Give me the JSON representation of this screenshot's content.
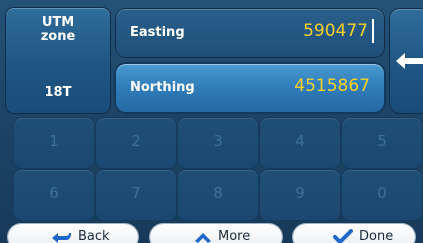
{
  "zone": {
    "title": "UTM\nzone",
    "value": "18T"
  },
  "easting": {
    "label": "Easting",
    "value": "590477"
  },
  "northing": {
    "label": "Northing",
    "value": "4515867"
  },
  "keypad": {
    "keys": [
      "1",
      "2",
      "3",
      "4",
      "5",
      "6",
      "7",
      "8",
      "9",
      "0"
    ]
  },
  "bottom": {
    "back_label": "Back",
    "more_label": "More",
    "done_label": "Done"
  },
  "colors": {
    "value_text": "#f4d22a",
    "panel": "#1f5583",
    "accent_check": "#1f67c9"
  },
  "icons": {
    "back": "back-arrow-icon",
    "more": "up-chevron-icon",
    "done": "checkmark-icon",
    "delete": "backspace-arrow-icon"
  }
}
